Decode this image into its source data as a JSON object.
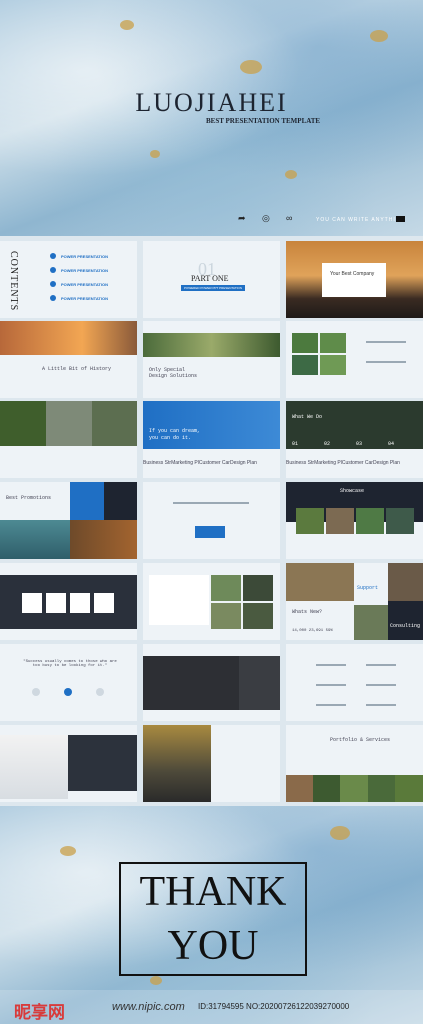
{
  "cover": {
    "title": "LUOJIAHEI",
    "subtitle": "BEST PRESENTATION TEMPLATE",
    "tagline": "YOU CAN WRITE ANYTHING",
    "icons": [
      "share-icon",
      "target-icon",
      "link-icon"
    ]
  },
  "contents": {
    "heading": "CONTENTS",
    "items": [
      {
        "num": "1",
        "label": "POWER PRESENTATION"
      },
      {
        "num": "2",
        "label": "POWER PRESENTATION"
      },
      {
        "num": "3",
        "label": "POWER PRESENTATION"
      },
      {
        "num": "4",
        "label": "POWER PRESENTATION"
      }
    ]
  },
  "part_one": {
    "number": "01",
    "title": "PART ONE",
    "caption": "POWERED POWER PPT PRESENTATION"
  },
  "sunset": {
    "title": "Your Best Company"
  },
  "history": {
    "title": "A Little Bit of History"
  },
  "solutions": {
    "title": "Only Special Design Solutions"
  },
  "dream": {
    "line1": "If you can dream,",
    "line2": "you can do it."
  },
  "what_we_do": {
    "title": "What We Do",
    "nums": [
      "01",
      "02",
      "03",
      "04"
    ]
  },
  "business_row": {
    "text": "Business StrMarketing PlCustomer CarDesign Plan"
  },
  "promotions": {
    "title": "Best Promotions"
  },
  "showcase": {
    "title": "Showcase"
  },
  "support": {
    "title": "Support"
  },
  "whats_new": {
    "title": "Whats New?",
    "stats": "14,000  23,691  59%"
  },
  "consulting": {
    "title": "Consulting"
  },
  "quote": {
    "text": "\"Success usually comes to those who are too busy to be looking for it.\""
  },
  "portfolio": {
    "title": "Portfolio & Services"
  },
  "thanks": {
    "line1": "THANK",
    "line2": "YOU"
  },
  "watermark": {
    "logo": "昵享网",
    "url": "www.nipic.com",
    "id": "ID:31794595 NO:20200726122039270000"
  }
}
